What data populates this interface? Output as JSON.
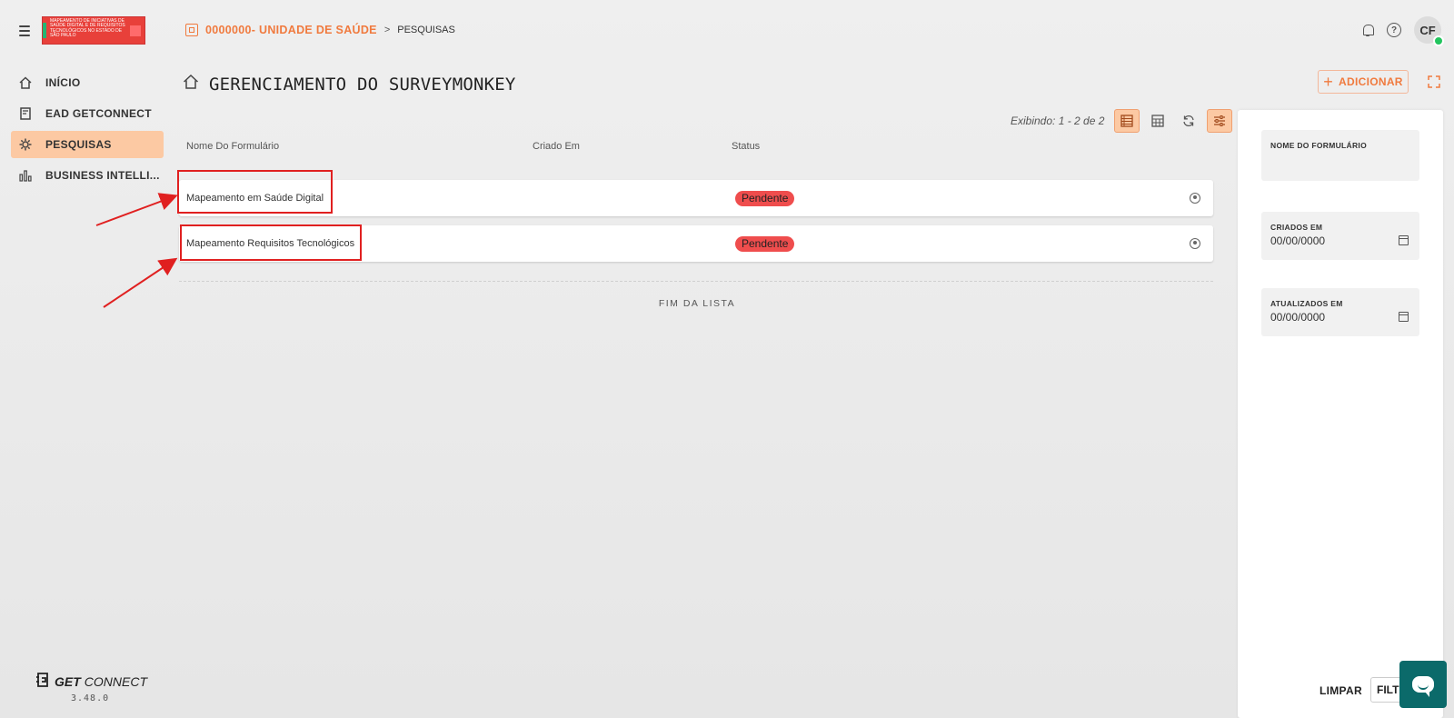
{
  "header": {
    "logo_text": "Mapeamento de iniciativas de Saúde Digital e de Requisitos Tecnológicos no Estado de São Paulo",
    "unit": "0000000- UNIDADE DE SAÚDE",
    "separator": ">",
    "current_page": "PESQUISAS",
    "avatar_initials": "CF"
  },
  "sidebar": {
    "items": [
      {
        "label": "INÍCIO",
        "icon": "home-icon"
      },
      {
        "label": "EAD GETCONNECT",
        "icon": "course-icon"
      },
      {
        "label": "PESQUISAS",
        "icon": "gear-icon",
        "active": true
      },
      {
        "label": "BUSINESS INTELLI...",
        "icon": "chart-icon"
      }
    ],
    "brand_bold": "GET",
    "brand_rest": "CONNECT",
    "version": "3.48.0"
  },
  "main": {
    "title": "GERENCIAMENTO DO SURVEYMONKEY",
    "add_label": "ADICIONAR",
    "showing": "Exibindo: 1 - 2 de 2",
    "columns": [
      "Nome Do Formulário",
      "Criado Em",
      "Status"
    ],
    "rows": [
      {
        "name": "Mapeamento em Saúde Digital",
        "status": "Pendente"
      },
      {
        "name": "Mapeamento Requisitos Tecnológicos",
        "status": "Pendente"
      }
    ],
    "end_of_list": "FIM DA LISTA"
  },
  "filters": {
    "form_name_label": "NOME DO FORMULÁRIO",
    "created_label": "CRIADOS EM",
    "created_placeholder": "00/00/0000",
    "updated_label": "ATUALIZADOS EM",
    "updated_placeholder": "00/00/0000",
    "clear_label": "LIMPAR",
    "filter_label": "FILTRAR"
  },
  "colors": {
    "accent": "#f07a3e",
    "active_nav": "#fcc9a3",
    "status_pending": "#ef4d4d",
    "annotation_red": "#e02020",
    "chat_button": "#0b6a6a"
  }
}
